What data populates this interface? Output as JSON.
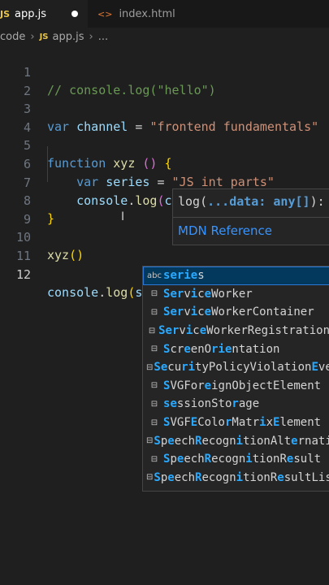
{
  "tabs": [
    {
      "icon": "JS",
      "label": "app.js",
      "modified": true
    },
    {
      "icon": "<>",
      "label": "index.html"
    }
  ],
  "breadcrumb": {
    "folder": "code",
    "file_icon": "JS",
    "file": "app.js",
    "more": "..."
  },
  "editor": {
    "line_numbers": [
      "1",
      "2",
      "3",
      "4",
      "5",
      "6",
      "7",
      "8",
      "9",
      "10",
      "11",
      "12"
    ],
    "line1": {
      "text": "// console.log(\"hello\")"
    },
    "line3": {
      "kw": "var",
      "name": "channel",
      "eq": " = ",
      "str": "\"frontend fundamentals\""
    },
    "line5": {
      "kw": "function",
      "name": "xyz",
      "paren": "()",
      "brace": "{"
    },
    "line6": {
      "kw": "var",
      "name": "series",
      "eq": " = ",
      "str": "\"JS int parts\""
    },
    "line7": {
      "obj": "console",
      "dot": ".",
      "fn": "log",
      "open": "(",
      "arg": "channel",
      "close": ")"
    },
    "line8": {
      "brace": "}"
    },
    "line10": {
      "fn": "xyz",
      "paren": "()"
    },
    "line12": {
      "obj": "console",
      "dot": ".",
      "fn": "log",
      "open": "(",
      "typed": "serie",
      "close": ")"
    }
  },
  "hover": {
    "fn": "log",
    "open": "(",
    "params": "...data: any[]",
    "close": "):",
    "link": "MDN Reference"
  },
  "suggestions": [
    {
      "icon": "abc",
      "label": "series"
    },
    {
      "icon": "symbol-icon",
      "label": "ServiceWorker"
    },
    {
      "icon": "symbol-icon",
      "label": "ServiceWorkerContainer"
    },
    {
      "icon": "symbol-icon",
      "label": "ServiceWorkerRegistration"
    },
    {
      "icon": "symbol-icon",
      "label": "ScreenOrientation"
    },
    {
      "icon": "symbol-icon",
      "label": "SecurityPolicyViolationEvent"
    },
    {
      "icon": "symbol-icon",
      "label": "SVGForeignObjectElement"
    },
    {
      "icon": "symbol-icon",
      "label": "sessionStorage"
    },
    {
      "icon": "symbol-icon",
      "label": "SVGFEColorMatrixElement"
    },
    {
      "icon": "symbol-icon",
      "label": "SpeechRecognitionAlternative"
    },
    {
      "icon": "symbol-icon",
      "label": "SpeechRecognitionResult"
    },
    {
      "icon": "symbol-icon",
      "label": "SpeechRecognitionResultList"
    }
  ],
  "colors": {
    "background": "#1f1f1f",
    "keyword": "#569cd6",
    "string": "#ce9178",
    "comment": "#6a9955",
    "match": "#2aaaff"
  }
}
